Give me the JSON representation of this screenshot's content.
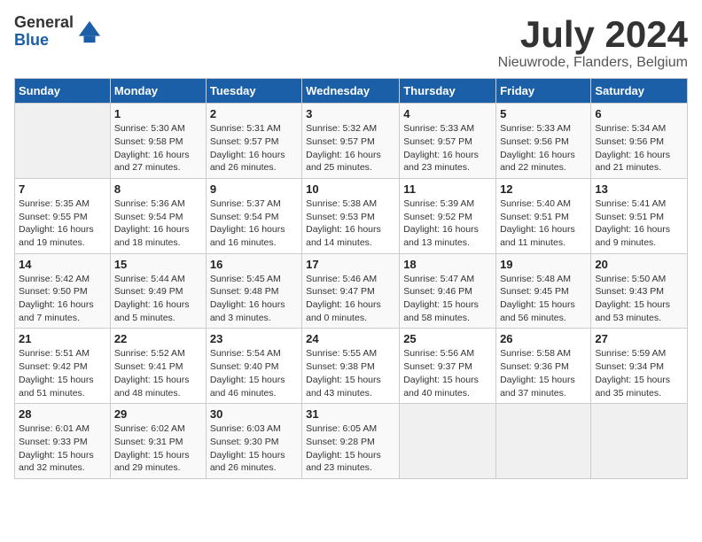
{
  "header": {
    "logo_general": "General",
    "logo_blue": "Blue",
    "month_title": "July 2024",
    "location": "Nieuwrode, Flanders, Belgium"
  },
  "weekdays": [
    "Sunday",
    "Monday",
    "Tuesday",
    "Wednesday",
    "Thursday",
    "Friday",
    "Saturday"
  ],
  "weeks": [
    [
      {
        "day": "",
        "info": ""
      },
      {
        "day": "1",
        "info": "Sunrise: 5:30 AM\nSunset: 9:58 PM\nDaylight: 16 hours\nand 27 minutes."
      },
      {
        "day": "2",
        "info": "Sunrise: 5:31 AM\nSunset: 9:57 PM\nDaylight: 16 hours\nand 26 minutes."
      },
      {
        "day": "3",
        "info": "Sunrise: 5:32 AM\nSunset: 9:57 PM\nDaylight: 16 hours\nand 25 minutes."
      },
      {
        "day": "4",
        "info": "Sunrise: 5:33 AM\nSunset: 9:57 PM\nDaylight: 16 hours\nand 23 minutes."
      },
      {
        "day": "5",
        "info": "Sunrise: 5:33 AM\nSunset: 9:56 PM\nDaylight: 16 hours\nand 22 minutes."
      },
      {
        "day": "6",
        "info": "Sunrise: 5:34 AM\nSunset: 9:56 PM\nDaylight: 16 hours\nand 21 minutes."
      }
    ],
    [
      {
        "day": "7",
        "info": "Sunrise: 5:35 AM\nSunset: 9:55 PM\nDaylight: 16 hours\nand 19 minutes."
      },
      {
        "day": "8",
        "info": "Sunrise: 5:36 AM\nSunset: 9:54 PM\nDaylight: 16 hours\nand 18 minutes."
      },
      {
        "day": "9",
        "info": "Sunrise: 5:37 AM\nSunset: 9:54 PM\nDaylight: 16 hours\nand 16 minutes."
      },
      {
        "day": "10",
        "info": "Sunrise: 5:38 AM\nSunset: 9:53 PM\nDaylight: 16 hours\nand 14 minutes."
      },
      {
        "day": "11",
        "info": "Sunrise: 5:39 AM\nSunset: 9:52 PM\nDaylight: 16 hours\nand 13 minutes."
      },
      {
        "day": "12",
        "info": "Sunrise: 5:40 AM\nSunset: 9:51 PM\nDaylight: 16 hours\nand 11 minutes."
      },
      {
        "day": "13",
        "info": "Sunrise: 5:41 AM\nSunset: 9:51 PM\nDaylight: 16 hours\nand 9 minutes."
      }
    ],
    [
      {
        "day": "14",
        "info": "Sunrise: 5:42 AM\nSunset: 9:50 PM\nDaylight: 16 hours\nand 7 minutes."
      },
      {
        "day": "15",
        "info": "Sunrise: 5:44 AM\nSunset: 9:49 PM\nDaylight: 16 hours\nand 5 minutes."
      },
      {
        "day": "16",
        "info": "Sunrise: 5:45 AM\nSunset: 9:48 PM\nDaylight: 16 hours\nand 3 minutes."
      },
      {
        "day": "17",
        "info": "Sunrise: 5:46 AM\nSunset: 9:47 PM\nDaylight: 16 hours\nand 0 minutes."
      },
      {
        "day": "18",
        "info": "Sunrise: 5:47 AM\nSunset: 9:46 PM\nDaylight: 15 hours\nand 58 minutes."
      },
      {
        "day": "19",
        "info": "Sunrise: 5:48 AM\nSunset: 9:45 PM\nDaylight: 15 hours\nand 56 minutes."
      },
      {
        "day": "20",
        "info": "Sunrise: 5:50 AM\nSunset: 9:43 PM\nDaylight: 15 hours\nand 53 minutes."
      }
    ],
    [
      {
        "day": "21",
        "info": "Sunrise: 5:51 AM\nSunset: 9:42 PM\nDaylight: 15 hours\nand 51 minutes."
      },
      {
        "day": "22",
        "info": "Sunrise: 5:52 AM\nSunset: 9:41 PM\nDaylight: 15 hours\nand 48 minutes."
      },
      {
        "day": "23",
        "info": "Sunrise: 5:54 AM\nSunset: 9:40 PM\nDaylight: 15 hours\nand 46 minutes."
      },
      {
        "day": "24",
        "info": "Sunrise: 5:55 AM\nSunset: 9:38 PM\nDaylight: 15 hours\nand 43 minutes."
      },
      {
        "day": "25",
        "info": "Sunrise: 5:56 AM\nSunset: 9:37 PM\nDaylight: 15 hours\nand 40 minutes."
      },
      {
        "day": "26",
        "info": "Sunrise: 5:58 AM\nSunset: 9:36 PM\nDaylight: 15 hours\nand 37 minutes."
      },
      {
        "day": "27",
        "info": "Sunrise: 5:59 AM\nSunset: 9:34 PM\nDaylight: 15 hours\nand 35 minutes."
      }
    ],
    [
      {
        "day": "28",
        "info": "Sunrise: 6:01 AM\nSunset: 9:33 PM\nDaylight: 15 hours\nand 32 minutes."
      },
      {
        "day": "29",
        "info": "Sunrise: 6:02 AM\nSunset: 9:31 PM\nDaylight: 15 hours\nand 29 minutes."
      },
      {
        "day": "30",
        "info": "Sunrise: 6:03 AM\nSunset: 9:30 PM\nDaylight: 15 hours\nand 26 minutes."
      },
      {
        "day": "31",
        "info": "Sunrise: 6:05 AM\nSunset: 9:28 PM\nDaylight: 15 hours\nand 23 minutes."
      },
      {
        "day": "",
        "info": ""
      },
      {
        "day": "",
        "info": ""
      },
      {
        "day": "",
        "info": ""
      }
    ]
  ]
}
